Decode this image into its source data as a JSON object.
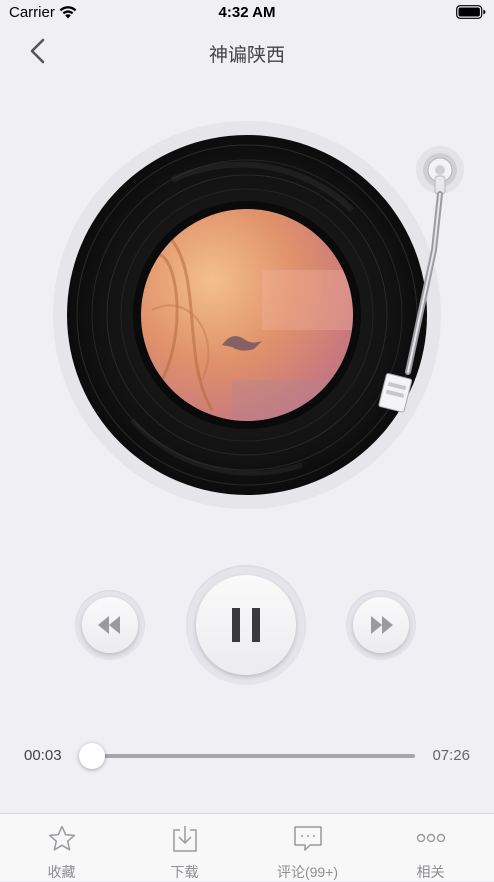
{
  "status_bar": {
    "carrier": "Carrier",
    "time": "4:32 AM"
  },
  "nav": {
    "title": "神谝陕西",
    "back_icon": "chevron-left-icon"
  },
  "player": {
    "state": "playing",
    "current_time": "00:03",
    "total_time": "07:26",
    "progress": 0.0067
  },
  "controls": {
    "prev_icon": "rewind-icon",
    "play_pause_icon": "pause-icon",
    "next_icon": "fast-forward-icon"
  },
  "tabs": [
    {
      "label": "收藏",
      "icon": "star-icon"
    },
    {
      "label": "下载",
      "icon": "download-icon"
    },
    {
      "label": "评论(99+)",
      "icon": "comment-icon"
    },
    {
      "label": "相关",
      "icon": "more-dots-icon"
    }
  ],
  "colors": {
    "background": "#efeff4",
    "record": "#141414",
    "tabbar": "#f8f8f8",
    "tab_text": "#8e8e93"
  }
}
